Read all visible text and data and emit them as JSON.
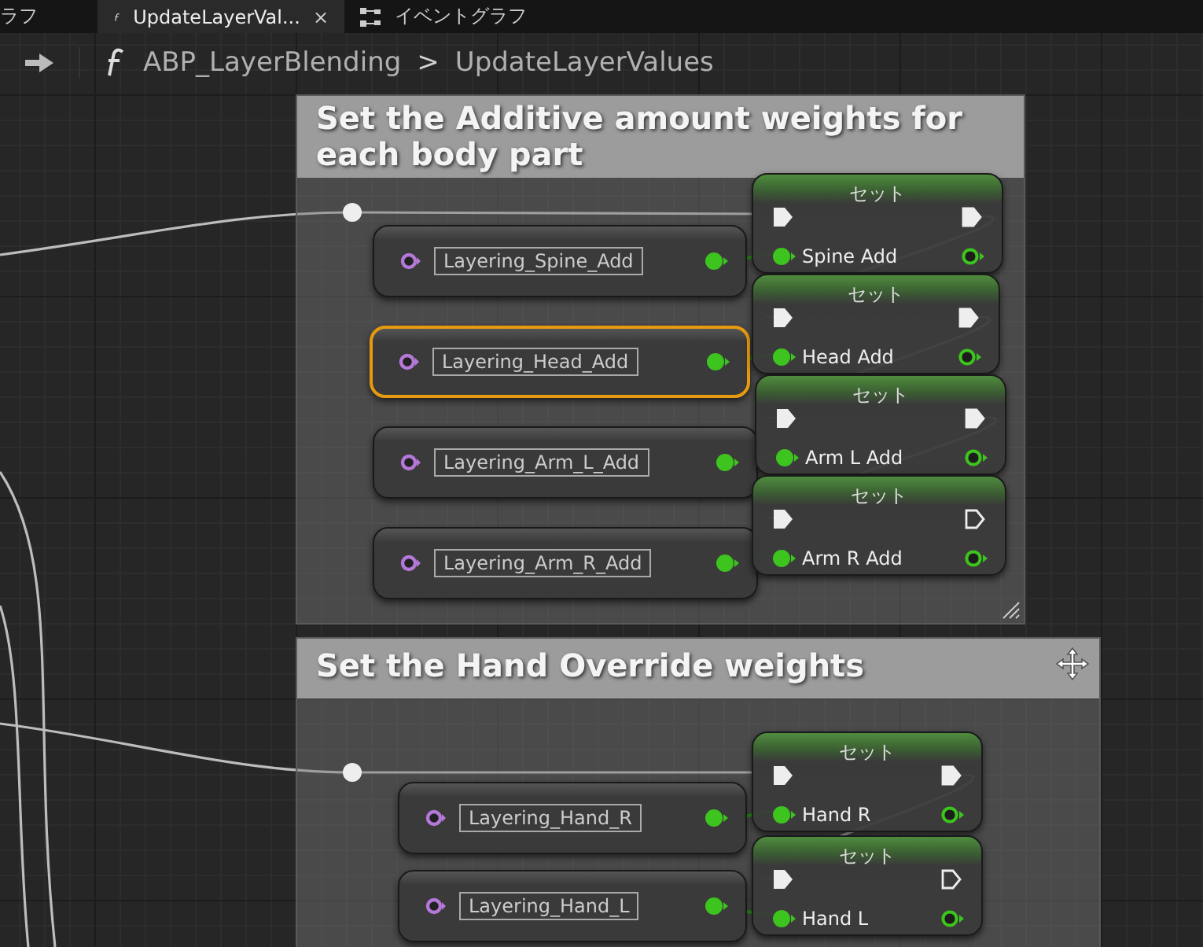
{
  "tabs": [
    {
      "label": "ラフ",
      "selected": false
    },
    {
      "label": "UpdateLayerVal...",
      "selected": true,
      "close": "×"
    },
    {
      "label": "イベントグラフ",
      "selected": false
    }
  ],
  "breadcrumb": {
    "path": "ABP_LayerBlending",
    "separator": ">",
    "current": "UpdateLayerValues"
  },
  "comments": [
    {
      "title": "Set the Additive amount weights for each body part",
      "nodes": [
        {
          "variable": "Layering_Spine_Add",
          "set_title": "セット",
          "target": "Spine Add",
          "selected": false,
          "exec_out_connected": true
        },
        {
          "variable": "Layering_Head_Add",
          "set_title": "セット",
          "target": "Head Add",
          "selected": true,
          "exec_out_connected": true
        },
        {
          "variable": "Layering_Arm_L_Add",
          "set_title": "セット",
          "target": "Arm L Add",
          "selected": false,
          "exec_out_connected": true
        },
        {
          "variable": "Layering_Arm_R_Add",
          "set_title": "セット",
          "target": "Arm R Add",
          "selected": false,
          "exec_out_connected": false
        }
      ]
    },
    {
      "title": "Set the Hand Override weights",
      "nodes": [
        {
          "variable": "Layering_Hand_R",
          "set_title": "セット",
          "target": "Hand R",
          "selected": false,
          "exec_out_connected": true
        },
        {
          "variable": "Layering_Hand_L",
          "set_title": "セット",
          "target": "Hand L",
          "selected": false,
          "exec_out_connected": false
        }
      ]
    }
  ]
}
